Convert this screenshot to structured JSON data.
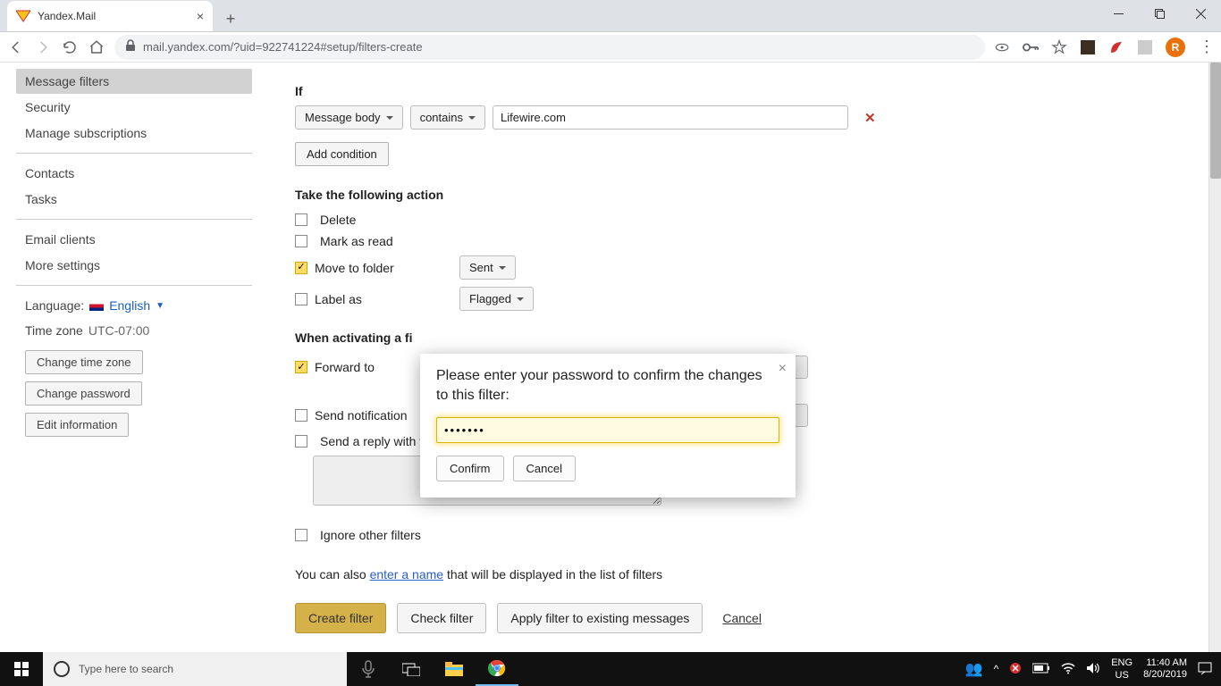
{
  "browser": {
    "tab_title": "Yandex.Mail",
    "url": "mail.yandex.com/?uid=922741224#setup/filters-create",
    "avatar_letter": "R"
  },
  "sidebar": {
    "items": [
      "Message filters",
      "Security",
      "Manage subscriptions"
    ],
    "items2": [
      "Contacts",
      "Tasks"
    ],
    "items3": [
      "Email clients",
      "More settings"
    ],
    "language_label": "Language:",
    "language_value": "English",
    "timezone_label": "Time zone",
    "timezone_value": "UTC-07:00",
    "btn_change_tz": "Change time zone",
    "btn_change_pw": "Change password",
    "btn_edit_info": "Edit information"
  },
  "filter": {
    "if_label": "If",
    "field_dd": "Message body",
    "op_dd": "contains",
    "value": "Lifewire.com",
    "add_condition": "Add condition",
    "action_label": "Take the following action",
    "actions": {
      "delete": "Delete",
      "mark_read": "Mark as read",
      "move": "Move to folder",
      "move_folder": "Sent",
      "label_as": "Label as",
      "label_value": "Flagged"
    },
    "when_label": "When activating a fi",
    "forward_to": "Forward to",
    "send_notif": "Send notification",
    "send_reply": "Send a reply with the following message",
    "ignore": "Ignore other filters",
    "footnote_pre": "You can also ",
    "footnote_link": "enter a name",
    "footnote_post": " that will be displayed in the list of filters",
    "btn_create": "Create filter",
    "btn_check": "Check filter",
    "btn_apply": "Apply filter to existing messages",
    "btn_cancel": "Cancel"
  },
  "modal": {
    "title": "Please enter your password to confirm the changes to this filter:",
    "password_value": "•••••••",
    "confirm": "Confirm",
    "cancel": "Cancel"
  },
  "taskbar": {
    "search_placeholder": "Type here to search",
    "lang1": "ENG",
    "lang2": "US",
    "time": "11:40 AM",
    "date": "8/20/2019"
  }
}
